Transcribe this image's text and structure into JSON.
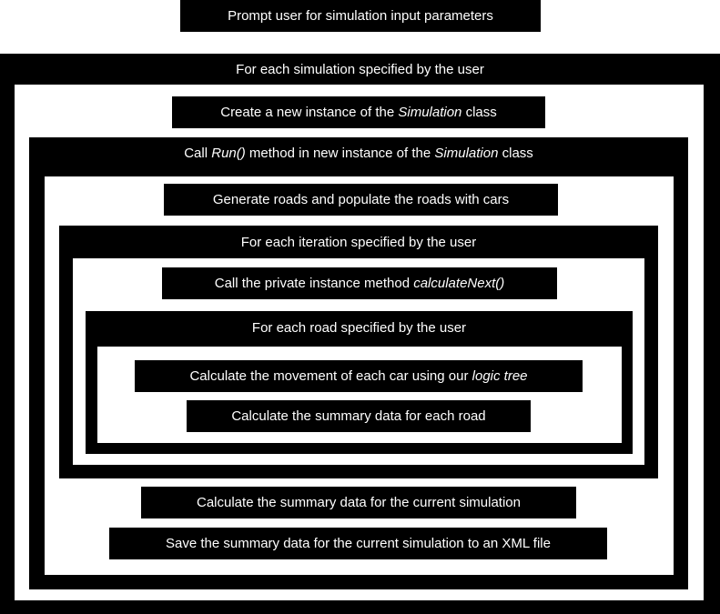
{
  "steps": {
    "prompt": "Prompt user for simulation input parameters",
    "loop_simulation": "For each simulation specified by the user",
    "create_instance": {
      "pre": "Create a new instance of the ",
      "em": "Simulation",
      "post": " class"
    },
    "call_run": {
      "pre": "Call ",
      "em": "Run()",
      "mid": " method in new instance of the ",
      "em2": "Simulation",
      "post": " class"
    },
    "generate_roads": "Generate roads and populate the roads with cars",
    "loop_iteration": "For each iteration specified by the user",
    "call_calculate_next": {
      "pre": "Call the private instance method ",
      "em": "calculateNext()"
    },
    "loop_road": "For each road specified by the user",
    "calc_movement": {
      "pre": "Calculate the movement of each car using our ",
      "em": "logic tree"
    },
    "calc_road_summary": "Calculate the summary data for each road",
    "calc_sim_summary": "Calculate the summary data for the current simulation",
    "save_summary": "Save the summary data for the current simulation to an XML file"
  },
  "colors": {
    "box": "#000000",
    "text": "#ffffff",
    "background": "#ffffff"
  }
}
